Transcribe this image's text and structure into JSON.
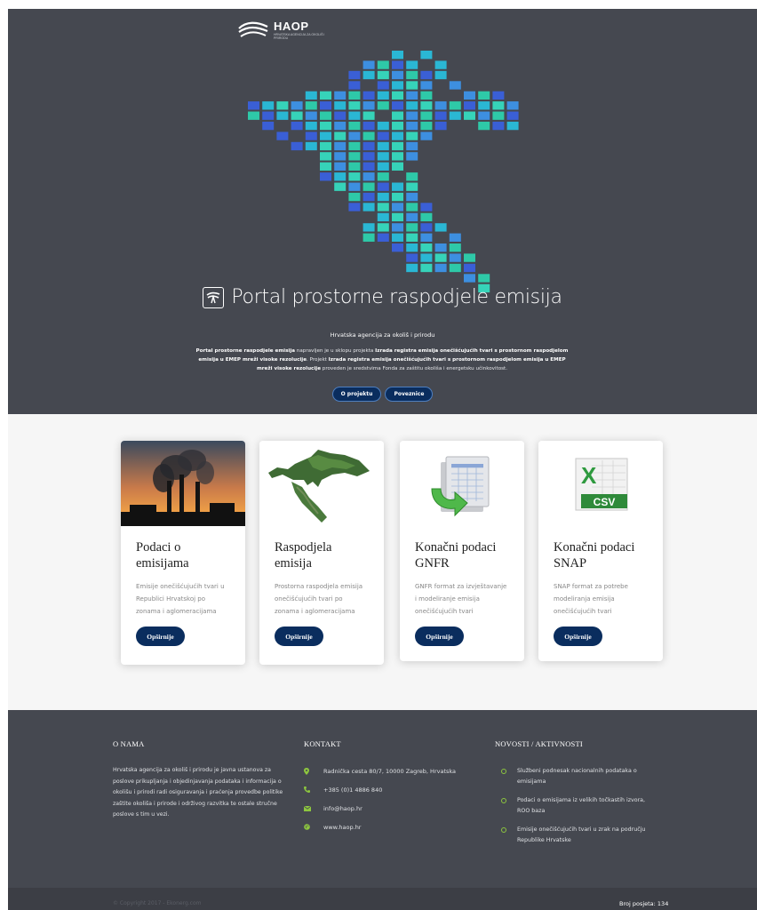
{
  "logo": {
    "title": "HAOP",
    "subtitle": "HRVATSKA AGENCIJA ZA OKOLIŠ I PRIRODU"
  },
  "hero": {
    "title": "Portal prostorne raspodjele emisija",
    "subtitle": "Hrvatska agencija za okoliš i prirodu",
    "description": {
      "p1_bold": "Portal prostorne raspodjele emisija",
      "p1_text": " napravljen je u sklopu projekta ",
      "p2_bold": "Izrada registra emisija onečišćujućih tvari s prostornom raspodjelom emisija u EMEP mreži visoke rezolucije",
      "p2_text": ". Projekt ",
      "p3_bold": "Izrada registra emisija onečišćujućih tvari s prostornom raspodjelom emisija u EMEP mreži visoke rezolucije",
      "p3_text": " proveden je sredstvima Fonda za zaštitu okoliša i energetsku učinkovitost."
    },
    "buttons": {
      "about": "O projektu",
      "links": "Poveznice"
    },
    "colors": [
      "#2ec9a8",
      "#2ab7d4",
      "#3d8fe0",
      "#3a5fd6",
      "#36d3b9"
    ]
  },
  "cards": [
    {
      "title": "Podaci o emisijama",
      "description": "Emisije onečišćujućih tvari u Republici Hrvatskoj po zonama i aglomeracijama",
      "button": "Opširnije",
      "image": "industrial-smoke-image"
    },
    {
      "title": "Raspodjela emisija",
      "description": "Prostorna raspodjela emisija onečišćujućih tvari po zonama i aglomeracijama",
      "button": "Opširnije",
      "image": "croatia-map-image"
    },
    {
      "title": "Konačni podaci GNFR",
      "description": "GNFR format za izvještavanje i modeliranje emisija onečišćujućih tvari",
      "button": "Opširnije",
      "image": "spreadsheet-export-icon"
    },
    {
      "title": "Konačni podaci SNAP",
      "description": "SNAP format za potrebe modeliranja emisija onečišćujućih tvari",
      "button": "Opširnije",
      "image": "excel-csv-icon",
      "badge": "CSV",
      "letter": "X"
    }
  ],
  "footer": {
    "about": {
      "heading": "O NAMA",
      "text": "Hrvatska agencija za okoliš i prirodu je javna ustanova za poslove prikupljanja i objedinjavanja podataka i informacija o okolišu i prirodi radi osiguravanja i praćenja provedbe politike zaštite okoliša i prirode i održivog razvitka te ostale stručne poslove s tim u vezi."
    },
    "contact": {
      "heading": "KONTAKT",
      "address": "Radnička cesta 80/7, 10000 Zagreb, Hrvatska",
      "phone": "+385 (0)1 4886 840",
      "email": "info@haop.hr",
      "web": "www.haop.hr"
    },
    "news": {
      "heading": "NOVOSTI / AKTIVNOSTI",
      "items": [
        "Službeni podnesak nacionalnih podataka o emisijama",
        "Podaci o emisijama iz velikih točkastih izvora, ROO baza",
        "Emisije onečišćujućih tvari u zrak na području Republike Hrvatske"
      ]
    },
    "copyright": "© Copyright 2017 - Ekonerg.com",
    "visits": "Broj posjeta: 134"
  },
  "accent_colors": {
    "navy": "#0a2d5e",
    "dark_gray": "#454850",
    "green": "#8dc63f"
  }
}
